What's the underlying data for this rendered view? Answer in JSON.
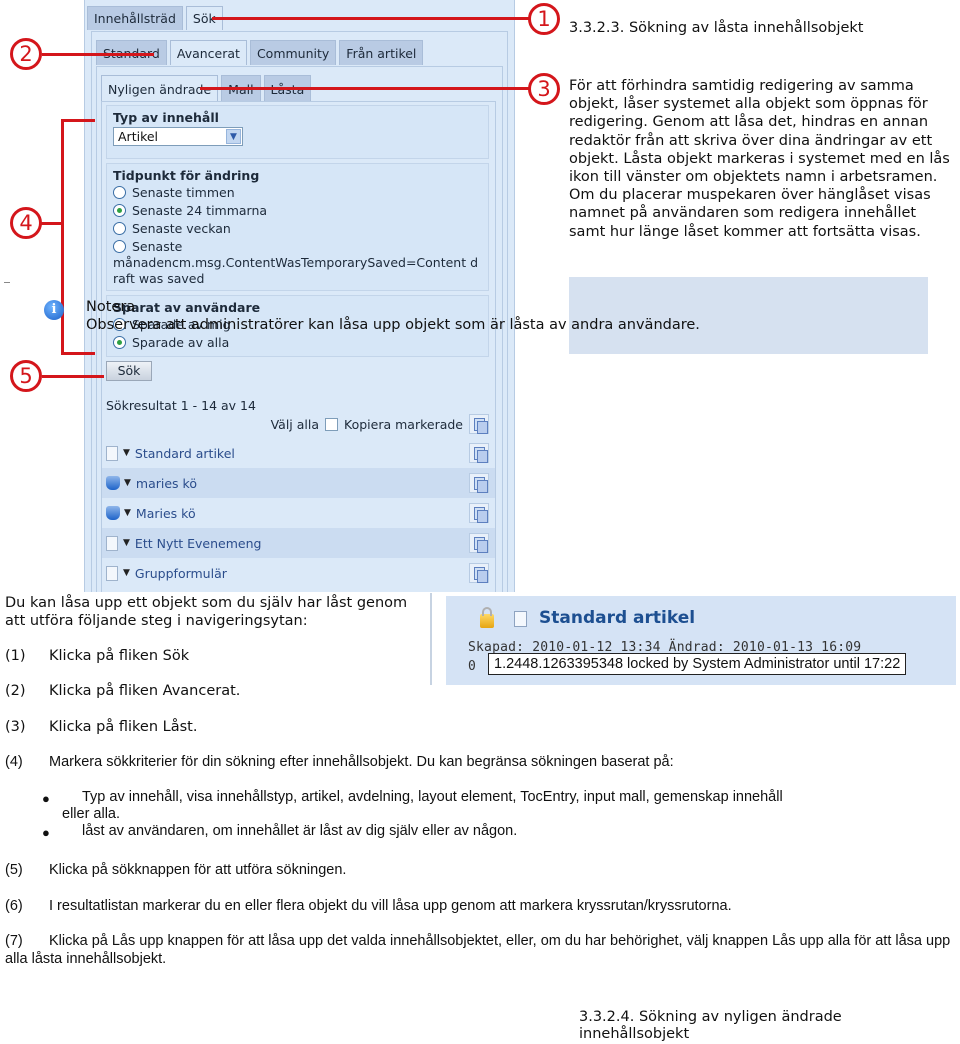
{
  "panel": {
    "tabs_level1": [
      "Innehållsträd",
      "Sök"
    ],
    "tabs_level1_active": 1,
    "tabs_level2": [
      "Standard",
      "Avancerat",
      "Community",
      "Från artikel"
    ],
    "tabs_level2_active": 1,
    "tabs_level3": [
      "Nyligen ändrade",
      "Mall",
      "Låsta"
    ],
    "tabs_level3_active": 0,
    "content_type": {
      "title": "Typ av innehåll",
      "selected": "Artikel"
    },
    "modified_time": {
      "title": "Tidpunkt för ändring",
      "options": [
        "Senaste timmen",
        "Senaste 24 timmarna",
        "Senaste veckan",
        "Senaste"
      ],
      "selected_index": 1,
      "message": "månadencm.msg.ContentWasTemporarySaved=Content draft was saved"
    },
    "saved_by": {
      "title": "Sparat av användare",
      "options": [
        "Sparade av mig",
        "Sparade av alla"
      ],
      "selected_index": 1
    },
    "search_button": "Sök",
    "results_count": "Sökresultat 1 - 14 av 14",
    "select_all_label": "Välj alla",
    "copy_selected_label": "Kopiera markerade",
    "results": [
      {
        "name": "Standard artikel",
        "icon": "document-icon"
      },
      {
        "name": "maries kö",
        "icon": "database-icon"
      },
      {
        "name": "Maries kö",
        "icon": "database-icon"
      },
      {
        "name": "Ett Nytt Evenemeng",
        "icon": "document-icon"
      },
      {
        "name": "Gruppformulär",
        "icon": "document-icon"
      }
    ]
  },
  "callouts": [
    "1",
    "2",
    "3",
    "4",
    "5"
  ],
  "section_title": "3.3.2.3. Sökning av låsta innehållsobjekt",
  "intro": "För att förhindra samtidig redigering av samma objekt, låser systemet alla objekt som öppnas för redigering. Genom att låsa det, hindras en annan redaktör från att skriva över dina ändringar av ett objekt. Låsta objekt markeras i systemet med en lås ikon till vänster om objektets namn i arbetsramen. Om du placerar muspekaren över hänglåset visas namnet på användaren som redigera innehållet samt hur länge låset kommer att fortsätta visas.",
  "note": {
    "label": "Notera",
    "text": "Observera att administratörer kan låsa upp objekt som är låsta av andra användare."
  },
  "lock_example": {
    "title": "Standard artikel",
    "meta": "Skapad: 2010-01-12 13:34  Ändrad: 2010-01-13 16:09",
    "meta2": "0",
    "tooltip": "1.2448.1263395348 locked by System Administrator until 17:22"
  },
  "instructions": {
    "intro": "Du kan låsa upp ett objekt som du själv har låst genom att utföra följande steg i navigeringsytan:",
    "steps": [
      {
        "num": "(1)",
        "text": "Klicka på fliken Sök"
      },
      {
        "num": "(2)",
        "text": "Klicka på fliken Avancerat."
      },
      {
        "num": "(3)",
        "text": "Klicka på fliken Låst."
      },
      {
        "num": "(4)",
        "text": "Markera sökkriterier för din sökning efter innehållsobjekt. Du kan begränsa sökningen baserat på:"
      },
      {
        "num": "(5)",
        "text": "Klicka på sökknappen för att utföra sökningen."
      },
      {
        "num": "(6)",
        "text": "I resultatlistan markerar du en eller flera objekt du vill låsa upp genom att markera kryssrutan/kryssrutorna."
      },
      {
        "num": "(7)",
        "text": "Klicka på Lås upp knappen för att låsa upp det valda innehållsobjektet, eller, om du har behörighet, välj knappen Lås upp alla för att låsa upp alla låsta innehållsobjekt."
      }
    ],
    "bullets": [
      {
        "first": "Typ av innehåll, visa innehållstyp, artikel, avdelning, layout element, TocEntry, input mall, gemenskap innehåll",
        "rest": "eller alla."
      },
      {
        "first": "låst av användaren, om innehållet är låst av dig själv eller av någon.",
        "rest": ""
      }
    ]
  },
  "next_section_title": "3.3.2.4. Sökning av nyligen ändrade innehållsobjekt"
}
